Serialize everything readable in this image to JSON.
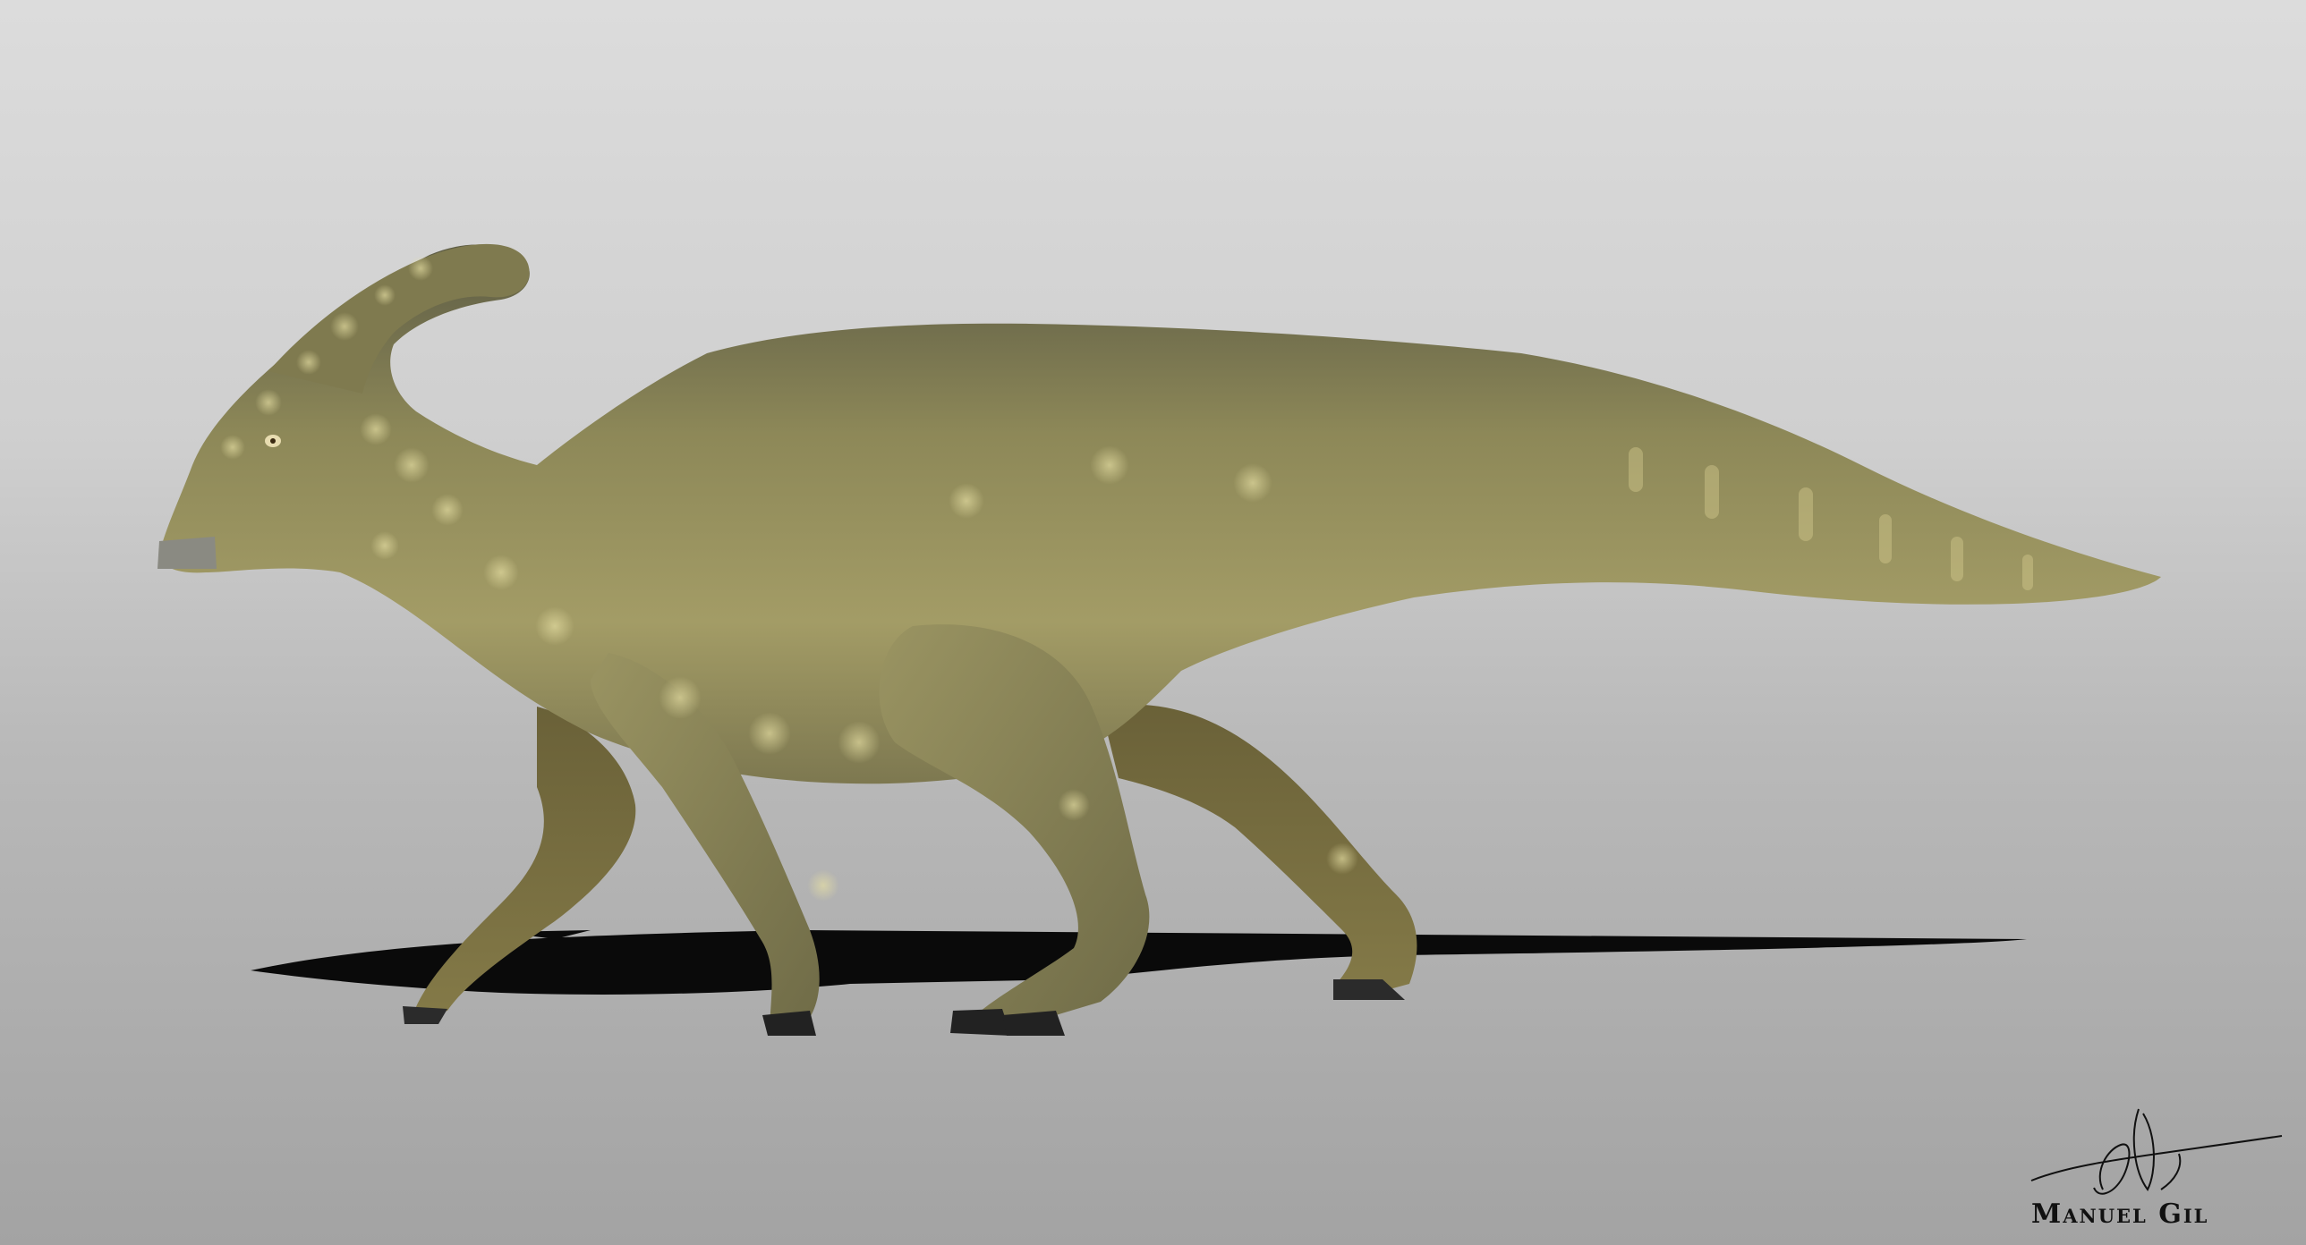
{
  "image": {
    "subject": "parasaurolophus-3d-render",
    "background_top": "#dcdcdc",
    "background_bottom": "#a3a3a3",
    "skin_base": "#8a8656",
    "skin_light": "#c9c28a",
    "skin_dark": "#4f4f3a",
    "shadow": "#0a0a0a"
  },
  "credit": {
    "text": "Manuel Gil"
  }
}
